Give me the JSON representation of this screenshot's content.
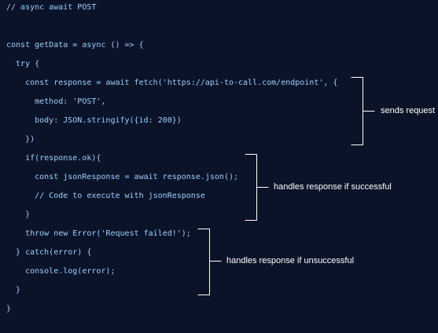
{
  "code": {
    "lines": [
      "// async await POST",
      "",
      "const getData = async () => {",
      "  try {",
      "    const response = await fetch('https://api-to-call.com/endpoint', {",
      "      method: 'POST',",
      "      body: JSON.stringify({id: 200})",
      "    })",
      "    if(response.ok){",
      "      const jsonResponse = await response.json();",
      "      // Code to execute with jsonResponse",
      "    }",
      "    throw new Error('Request failed!');",
      "  } catch(error) {",
      "    console.log(error);",
      "  }",
      "}"
    ]
  },
  "annotations": {
    "sends_request": "sends request",
    "handles_success": "handles response if successful",
    "handles_failure": "handles response if unsuccessful"
  },
  "colors": {
    "background": "#0b1329",
    "code_text": "#9ad0ff",
    "annotation_text": "#ffffff",
    "bracket": "#ffffff"
  }
}
